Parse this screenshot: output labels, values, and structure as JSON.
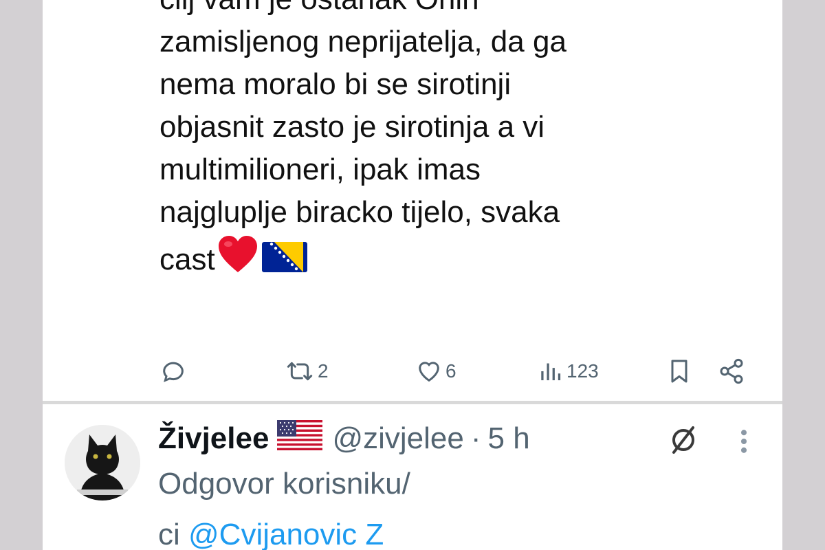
{
  "tweet": {
    "lines": [
      "cilj vam je ostanak Onih",
      "zamisljenog neprijatelja, da ga",
      "nema moralo bi se sirotinji",
      "objasnit zasto je sirotinja a vi",
      "multimilioneri, ipak imas",
      "najgluplje biracko tijelo, svaka",
      "cast"
    ],
    "emojis": [
      "heart-emoji",
      "bosnia-flag-emoji"
    ]
  },
  "actions": {
    "reply_count": "",
    "retweet_count": "2",
    "like_count": "6",
    "views_count": "123",
    "icons": [
      "reply-icon",
      "retweet-icon",
      "like-icon",
      "views-icon",
      "bookmark-icon",
      "share-icon"
    ]
  },
  "reply": {
    "display_name": "Živjelee",
    "flag_icon": "us-flag-emoji",
    "handle": "@zivjelee",
    "separator": "·",
    "time": "5 h",
    "replying_to_label": "Odgovor korisniku/",
    "replying_prefix": "ci ",
    "mention": "@Cvijanovic Z"
  },
  "colors": {
    "background": "#d3d0d3",
    "card": "#ffffff",
    "text": "#0f1419",
    "muted": "#536471",
    "link": "#1d9bf0",
    "heart": "#e8112d",
    "flag_blue": "#002395",
    "flag_yellow": "#fecb00"
  }
}
